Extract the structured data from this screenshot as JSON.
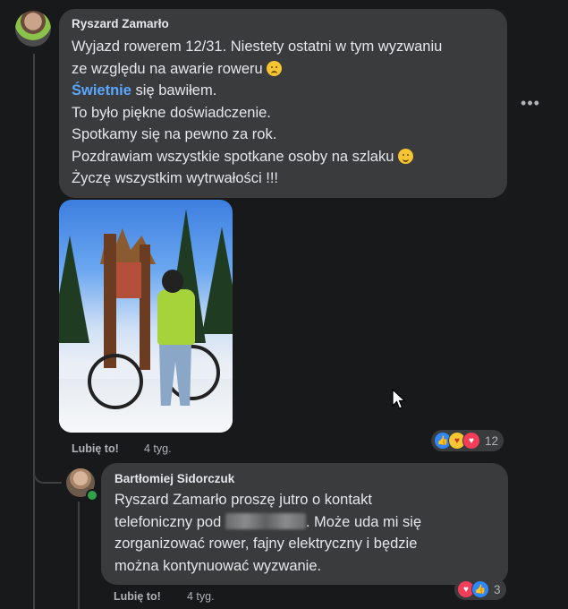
{
  "comment": {
    "author": "Ryszard Zamarło",
    "lines": [
      "Wyjazd rowerem 12/31. Niestety ostatni w tym wyzwaniu",
      "ze względu na awarie roweru",
      "się bawiłem.",
      "To było piękne doświadczenie.",
      "Spotkamy się na pewno za rok.",
      "Pozdrawiam wszystkie spotkane osoby na szlaku",
      "Życzę wszystkim wytrwałości !!!"
    ],
    "highlight_word": "Świetnie",
    "like_label": "Lubię to!",
    "time": "4 tyg.",
    "reaction_count": "12",
    "reaction_icons": [
      "like-icon",
      "care-icon",
      "love-icon"
    ]
  },
  "reply": {
    "author": "Bartłomiej Sidorczuk",
    "lines": [
      "Ryszard Zamarło proszę jutro o kontakt",
      "telefoniczny pod",
      ". Może uda mi się",
      "zorganizować rower, fajny elektryczny i będzie",
      "można kontynuować wyzwanie."
    ],
    "like_label": "Lubię to!",
    "time": "4 tyg.",
    "reaction_count": "3",
    "reaction_icons": [
      "love-icon",
      "like-icon"
    ]
  },
  "more_options_label": "•••",
  "colors": {
    "background": "#18191a",
    "bubble": "#3a3b3c",
    "text": "#e4e6eb",
    "muted": "#b0b3b8",
    "mention": "#5aa7ff",
    "online": "#31a24c"
  }
}
